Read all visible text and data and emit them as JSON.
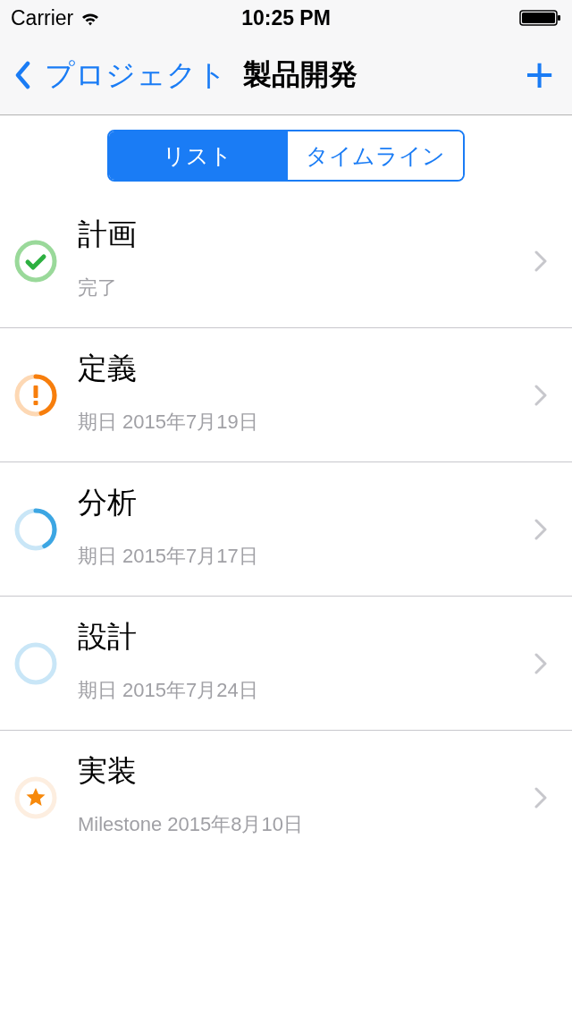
{
  "status_bar": {
    "carrier": "Carrier",
    "time": "10:25 PM"
  },
  "nav": {
    "back": "プロジェクト",
    "title": "製品開発",
    "add": "+"
  },
  "segments": [
    {
      "label": "リスト",
      "selected": true
    },
    {
      "label": "タイムライン",
      "selected": false
    }
  ],
  "tasks": [
    {
      "kind": "done",
      "title": "計画",
      "subtitle": "完了"
    },
    {
      "kind": "overdue",
      "title": "定義",
      "subtitle": "期日 2015年7月19日"
    },
    {
      "kind": "started",
      "title": "分析",
      "subtitle": "期日 2015年7月17日"
    },
    {
      "kind": "pending",
      "title": "設計",
      "subtitle": "期日 2015年7月24日"
    },
    {
      "kind": "milestone",
      "title": "実装",
      "subtitle": "Milestone 2015年8月10日"
    }
  ]
}
